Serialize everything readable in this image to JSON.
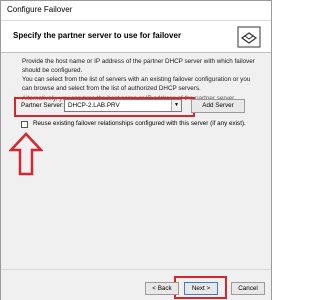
{
  "window": {
    "title": "Configure Failover"
  },
  "header": {
    "title": "Specify the partner server to use for failover",
    "icon": "server-network-icon"
  },
  "content": {
    "paragraph1": "Provide the host name or IP address of the partner DHCP server with which failover should be configured.",
    "paragraph2": "You can select from the list of servers with an existing failover configuration or you can browse and select from the list of authorized DHCP servers.",
    "paragraph3": "Alternatively, you can type the host name or IP address of the partner server.",
    "partner_server_label": "Partner Server:",
    "partner_server_value": "DHCP-2.LAB.PRV",
    "add_server_label": "Add Server",
    "reuse_label": "Reuse existing failover relationships configured with this server (if any exist)."
  },
  "footer": {
    "back_label": "< Back",
    "next_label": "Next >",
    "cancel_label": "Cancel"
  },
  "colors": {
    "highlight": "#d8262e",
    "window_bg": "#f0f0f0"
  }
}
